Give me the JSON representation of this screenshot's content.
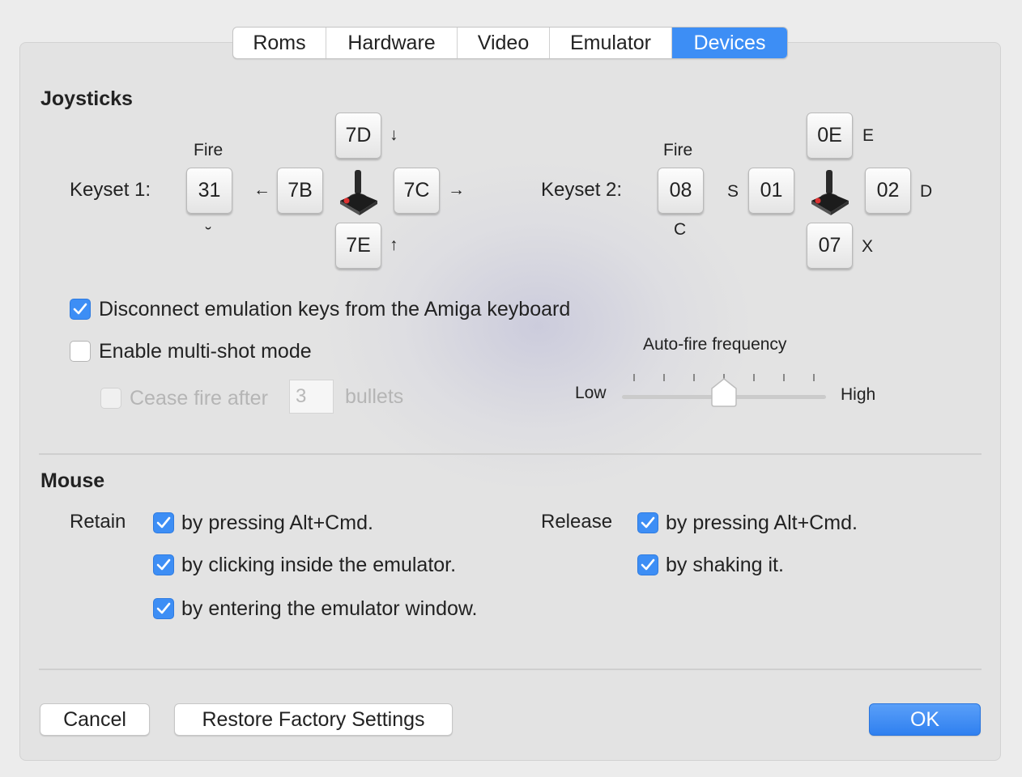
{
  "tabs": [
    {
      "label": "Roms",
      "active": false
    },
    {
      "label": "Hardware",
      "active": false
    },
    {
      "label": "Video",
      "active": false
    },
    {
      "label": "Emulator",
      "active": false
    },
    {
      "label": "Devices",
      "active": true
    }
  ],
  "joysticks": {
    "title": "Joysticks",
    "keyset1": {
      "label": "Keyset 1:",
      "fire_label": "Fire",
      "fire_key": "31",
      "fire_char": "˘",
      "left_key": "7B",
      "left_arrow": "←",
      "right_key": "7C",
      "right_arrow": "→",
      "up_key": "7D",
      "up_arrow": "↓",
      "down_key": "7E",
      "down_arrow": "↑"
    },
    "keyset2": {
      "label": "Keyset 2:",
      "fire_label": "Fire",
      "fire_key": "08",
      "fire_char": "C",
      "left_key": "01",
      "left_char": "S",
      "right_key": "02",
      "right_char": "D",
      "up_key": "0E",
      "up_char": "E",
      "down_key": "07",
      "down_char": "X"
    },
    "disconnect_label": "Disconnect emulation keys from the Amiga keyboard",
    "disconnect_checked": true,
    "multishot_label": "Enable multi-shot mode",
    "multishot_checked": false,
    "cease_fire_label": "Cease fire after",
    "cease_fire_value": "3",
    "bullets_label": "bullets",
    "autofire": {
      "title": "Auto-fire frequency",
      "low": "Low",
      "high": "High",
      "value_fraction": 0.5
    }
  },
  "mouse": {
    "title": "Mouse",
    "retain_label": "Retain",
    "release_label": "Release",
    "retain_options": [
      {
        "label": "by pressing Alt+Cmd.",
        "checked": true
      },
      {
        "label": "by clicking inside the emulator.",
        "checked": true
      },
      {
        "label": "by entering the emulator window.",
        "checked": true
      }
    ],
    "release_options": [
      {
        "label": "by pressing Alt+Cmd.",
        "checked": true
      },
      {
        "label": "by shaking it.",
        "checked": true
      }
    ]
  },
  "buttons": {
    "cancel": "Cancel",
    "restore": "Restore Factory Settings",
    "ok": "OK"
  },
  "colors": {
    "accent": "#3d8ef5"
  },
  "icons": [
    "joystick-icon",
    "checkmark-icon"
  ]
}
